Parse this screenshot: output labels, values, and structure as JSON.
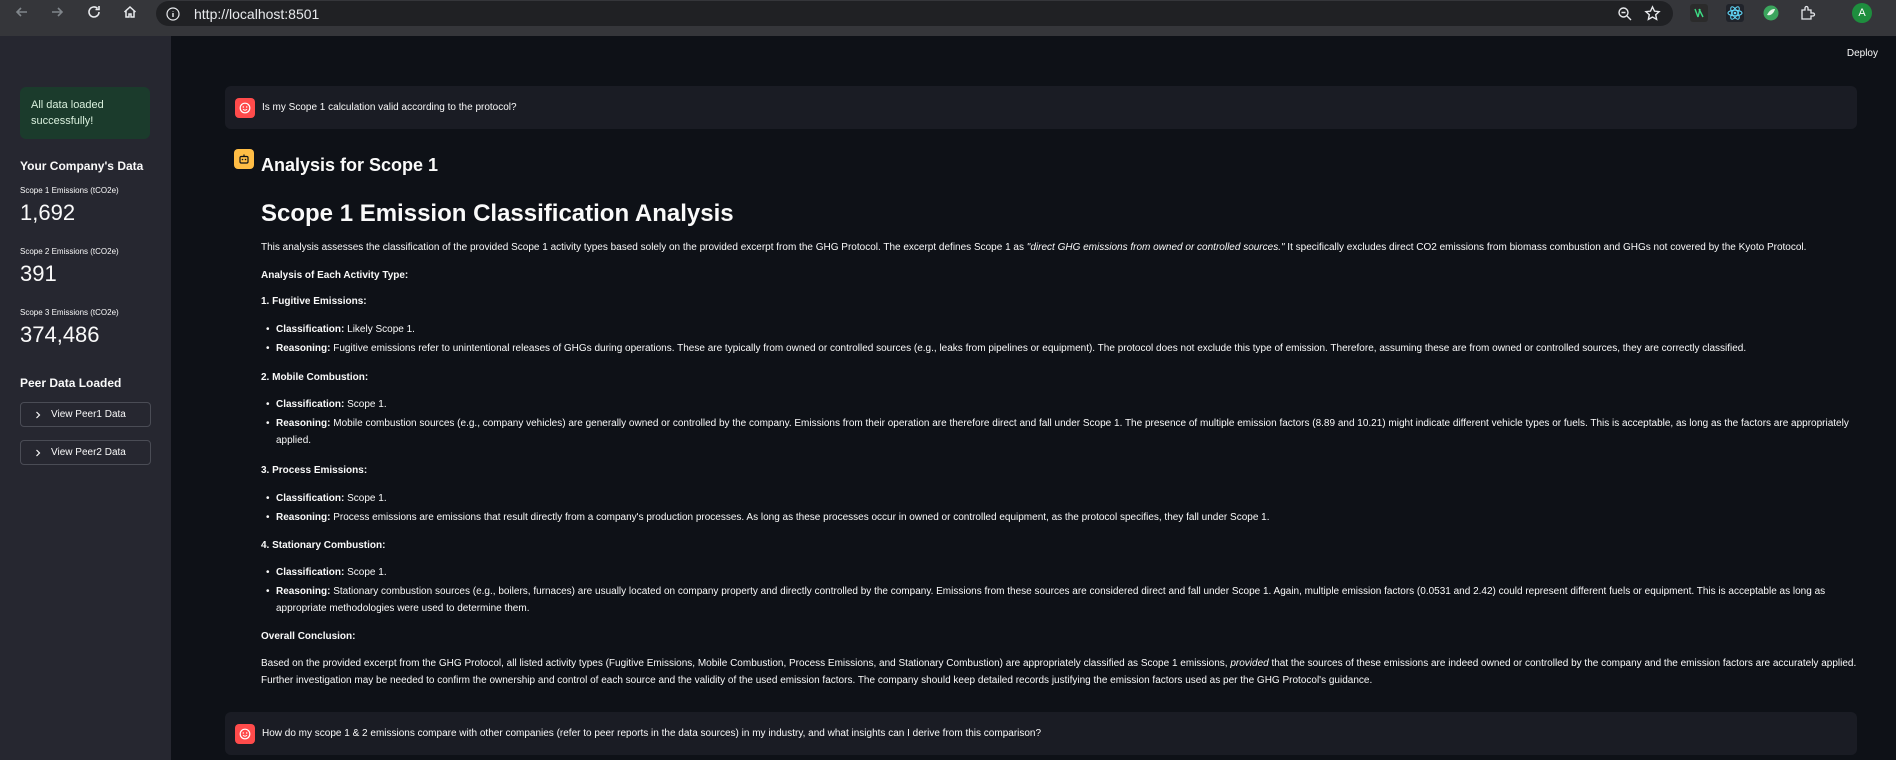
{
  "browser": {
    "url": "http://localhost:8501",
    "profile_initial": "A"
  },
  "sidebar": {
    "success_text": "All data loaded successfully!",
    "company_header": "Your Company's Data",
    "metrics": [
      {
        "label": "Scope 1 Emissions (tCO2e)",
        "value": "1,692"
      },
      {
        "label": "Scope 2 Emissions (tCO2e)",
        "value": "391"
      },
      {
        "label": "Scope 3 Emissions (tCO2e)",
        "value": "374,486"
      }
    ],
    "peer_header": "Peer Data Loaded",
    "peer_buttons": [
      "View Peer1 Data",
      "View Peer2 Data"
    ]
  },
  "main": {
    "deploy_label": "Deploy",
    "question1": "Is my Scope 1 calculation valid according to the protocol?",
    "analysis_heading": "Analysis for Scope 1",
    "title": "Scope 1 Emission Classification Analysis",
    "intro_a": "This analysis assesses the classification of the provided Scope 1 activity types based solely on the provided excerpt from the GHG Protocol. The excerpt defines Scope 1 as ",
    "intro_quote": "\"direct GHG emissions from owned or controlled sources.\"",
    "intro_b": " It specifically excludes direct CO2 emissions from biomass combustion and GHGs not covered by the Kyoto Protocol.",
    "analysis_label": "Analysis of Each Activity Type:",
    "classification_label": "Classification:",
    "reasoning_label": "Reasoning:",
    "sections": [
      {
        "title": "1. Fugitive Emissions:",
        "classification": "Likely Scope 1.",
        "reasoning": "Fugitive emissions refer to unintentional releases of GHGs during operations. These are typically from owned or controlled sources (e.g., leaks from pipelines or equipment). The protocol does not exclude this type of emission. Therefore, assuming these are from owned or controlled sources, they are correctly classified."
      },
      {
        "title": "2. Mobile Combustion:",
        "classification": "Scope 1.",
        "reasoning_line1": "Mobile combustion sources (e.g., company vehicles) are generally owned or controlled by the company. Emissions from their operation are therefore direct and fall under Scope 1. The presence of multiple emission factors (8.89 and 10.21) might indicate different vehicle types or fuels. This is acceptable, as long as the factors are appropriately",
        "reasoning_line2": "applied."
      },
      {
        "title": "3. Process Emissions:",
        "classification": "Scope 1.",
        "reasoning": "Process emissions are emissions that result directly from a company's production processes. As long as these processes occur in owned or controlled equipment, as the protocol specifies, they fall under Scope 1."
      },
      {
        "title": "4. Stationary Combustion:",
        "classification": "Scope 1.",
        "reasoning_line1": "Stationary combustion sources (e.g., boilers, furnaces) are usually located on company property and directly controlled by the company. Emissions from these sources are considered direct and fall under Scope 1. Again, multiple emission factors (0.0531 and 2.42) could represent different fuels or equipment. This is acceptable as long as",
        "reasoning_line2": "appropriate methodologies were used to determine them."
      }
    ],
    "conclusion_label": "Overall Conclusion:",
    "conclusion_a": "Based on the provided excerpt from the GHG Protocol, all listed activity types (Fugitive Emissions, Mobile Combustion, Process Emissions, and Stationary Combustion) are appropriately classified as Scope 1 emissions, ",
    "conclusion_em": "provided",
    "conclusion_b": " that the sources of these emissions are indeed owned or controlled by the company and the emission factors are accurately applied.",
    "conclusion_line2": "Further investigation may be needed to confirm the ownership and control of each source and the validity of the used emission factors. The company should keep detailed records justifying the emission factors used as per the GHG Protocol's guidance.",
    "question2": "How do my scope 1 & 2 emissions compare with other companies (refer to peer reports in the data sources) in my industry, and what insights can I derive from this comparison?"
  }
}
